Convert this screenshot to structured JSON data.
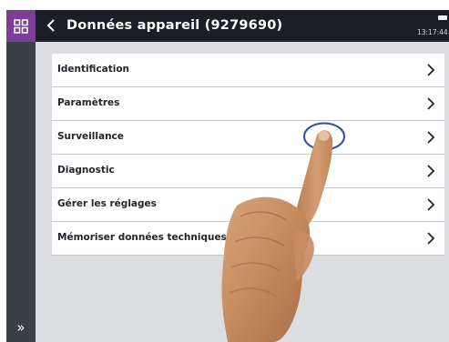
{
  "header": {
    "title": "Données appareil (9279690)",
    "time": "13:17:44"
  },
  "menu": {
    "items": [
      {
        "label": "Identification"
      },
      {
        "label": "Paramètres"
      },
      {
        "label": "Surveillance"
      },
      {
        "label": "Diagnostic"
      },
      {
        "label": "Gérer les réglages"
      },
      {
        "label": "Mémoriser données techniques"
      }
    ]
  },
  "sidebar": {
    "expand_icon": "double-chevron-right-icon",
    "expand_glyph": "»"
  },
  "icons": {
    "app_grid": "app-grid-icon",
    "back": "chevron-left-icon",
    "row_chevron": "chevron-right-icon"
  },
  "colors": {
    "accent": "#7b3f98",
    "topbar": "#1b1e24",
    "sidebar": "#3b3f46",
    "background": "#dcdde0",
    "touch_ring": "#2f4f9e"
  }
}
